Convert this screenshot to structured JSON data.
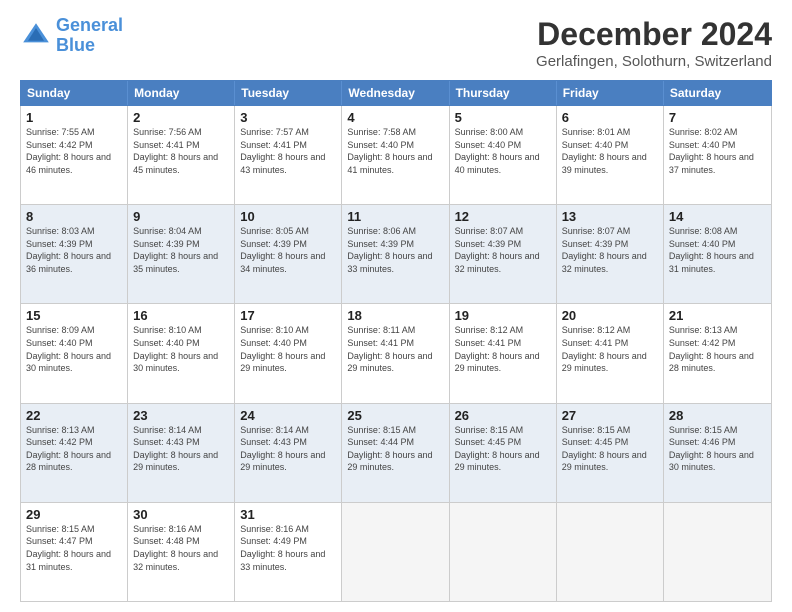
{
  "logo": {
    "line1": "General",
    "line2": "Blue"
  },
  "title": "December 2024",
  "subtitle": "Gerlafingen, Solothurn, Switzerland",
  "days": [
    "Sunday",
    "Monday",
    "Tuesday",
    "Wednesday",
    "Thursday",
    "Friday",
    "Saturday"
  ],
  "weeks": [
    [
      {
        "day": "1",
        "sunrise": "7:55 AM",
        "sunset": "4:42 PM",
        "daylight": "8 hours and 46 minutes."
      },
      {
        "day": "2",
        "sunrise": "7:56 AM",
        "sunset": "4:41 PM",
        "daylight": "8 hours and 45 minutes."
      },
      {
        "day": "3",
        "sunrise": "7:57 AM",
        "sunset": "4:41 PM",
        "daylight": "8 hours and 43 minutes."
      },
      {
        "day": "4",
        "sunrise": "7:58 AM",
        "sunset": "4:40 PM",
        "daylight": "8 hours and 41 minutes."
      },
      {
        "day": "5",
        "sunrise": "8:00 AM",
        "sunset": "4:40 PM",
        "daylight": "8 hours and 40 minutes."
      },
      {
        "day": "6",
        "sunrise": "8:01 AM",
        "sunset": "4:40 PM",
        "daylight": "8 hours and 39 minutes."
      },
      {
        "day": "7",
        "sunrise": "8:02 AM",
        "sunset": "4:40 PM",
        "daylight": "8 hours and 37 minutes."
      }
    ],
    [
      {
        "day": "8",
        "sunrise": "8:03 AM",
        "sunset": "4:39 PM",
        "daylight": "8 hours and 36 minutes."
      },
      {
        "day": "9",
        "sunrise": "8:04 AM",
        "sunset": "4:39 PM",
        "daylight": "8 hours and 35 minutes."
      },
      {
        "day": "10",
        "sunrise": "8:05 AM",
        "sunset": "4:39 PM",
        "daylight": "8 hours and 34 minutes."
      },
      {
        "day": "11",
        "sunrise": "8:06 AM",
        "sunset": "4:39 PM",
        "daylight": "8 hours and 33 minutes."
      },
      {
        "day": "12",
        "sunrise": "8:07 AM",
        "sunset": "4:39 PM",
        "daylight": "8 hours and 32 minutes."
      },
      {
        "day": "13",
        "sunrise": "8:07 AM",
        "sunset": "4:39 PM",
        "daylight": "8 hours and 32 minutes."
      },
      {
        "day": "14",
        "sunrise": "8:08 AM",
        "sunset": "4:40 PM",
        "daylight": "8 hours and 31 minutes."
      }
    ],
    [
      {
        "day": "15",
        "sunrise": "8:09 AM",
        "sunset": "4:40 PM",
        "daylight": "8 hours and 30 minutes."
      },
      {
        "day": "16",
        "sunrise": "8:10 AM",
        "sunset": "4:40 PM",
        "daylight": "8 hours and 30 minutes."
      },
      {
        "day": "17",
        "sunrise": "8:10 AM",
        "sunset": "4:40 PM",
        "daylight": "8 hours and 29 minutes."
      },
      {
        "day": "18",
        "sunrise": "8:11 AM",
        "sunset": "4:41 PM",
        "daylight": "8 hours and 29 minutes."
      },
      {
        "day": "19",
        "sunrise": "8:12 AM",
        "sunset": "4:41 PM",
        "daylight": "8 hours and 29 minutes."
      },
      {
        "day": "20",
        "sunrise": "8:12 AM",
        "sunset": "4:41 PM",
        "daylight": "8 hours and 29 minutes."
      },
      {
        "day": "21",
        "sunrise": "8:13 AM",
        "sunset": "4:42 PM",
        "daylight": "8 hours and 28 minutes."
      }
    ],
    [
      {
        "day": "22",
        "sunrise": "8:13 AM",
        "sunset": "4:42 PM",
        "daylight": "8 hours and 28 minutes."
      },
      {
        "day": "23",
        "sunrise": "8:14 AM",
        "sunset": "4:43 PM",
        "daylight": "8 hours and 29 minutes."
      },
      {
        "day": "24",
        "sunrise": "8:14 AM",
        "sunset": "4:43 PM",
        "daylight": "8 hours and 29 minutes."
      },
      {
        "day": "25",
        "sunrise": "8:15 AM",
        "sunset": "4:44 PM",
        "daylight": "8 hours and 29 minutes."
      },
      {
        "day": "26",
        "sunrise": "8:15 AM",
        "sunset": "4:45 PM",
        "daylight": "8 hours and 29 minutes."
      },
      {
        "day": "27",
        "sunrise": "8:15 AM",
        "sunset": "4:45 PM",
        "daylight": "8 hours and 29 minutes."
      },
      {
        "day": "28",
        "sunrise": "8:15 AM",
        "sunset": "4:46 PM",
        "daylight": "8 hours and 30 minutes."
      }
    ],
    [
      {
        "day": "29",
        "sunrise": "8:15 AM",
        "sunset": "4:47 PM",
        "daylight": "8 hours and 31 minutes."
      },
      {
        "day": "30",
        "sunrise": "8:16 AM",
        "sunset": "4:48 PM",
        "daylight": "8 hours and 32 minutes."
      },
      {
        "day": "31",
        "sunrise": "8:16 AM",
        "sunset": "4:49 PM",
        "daylight": "8 hours and 33 minutes."
      },
      null,
      null,
      null,
      null
    ]
  ]
}
